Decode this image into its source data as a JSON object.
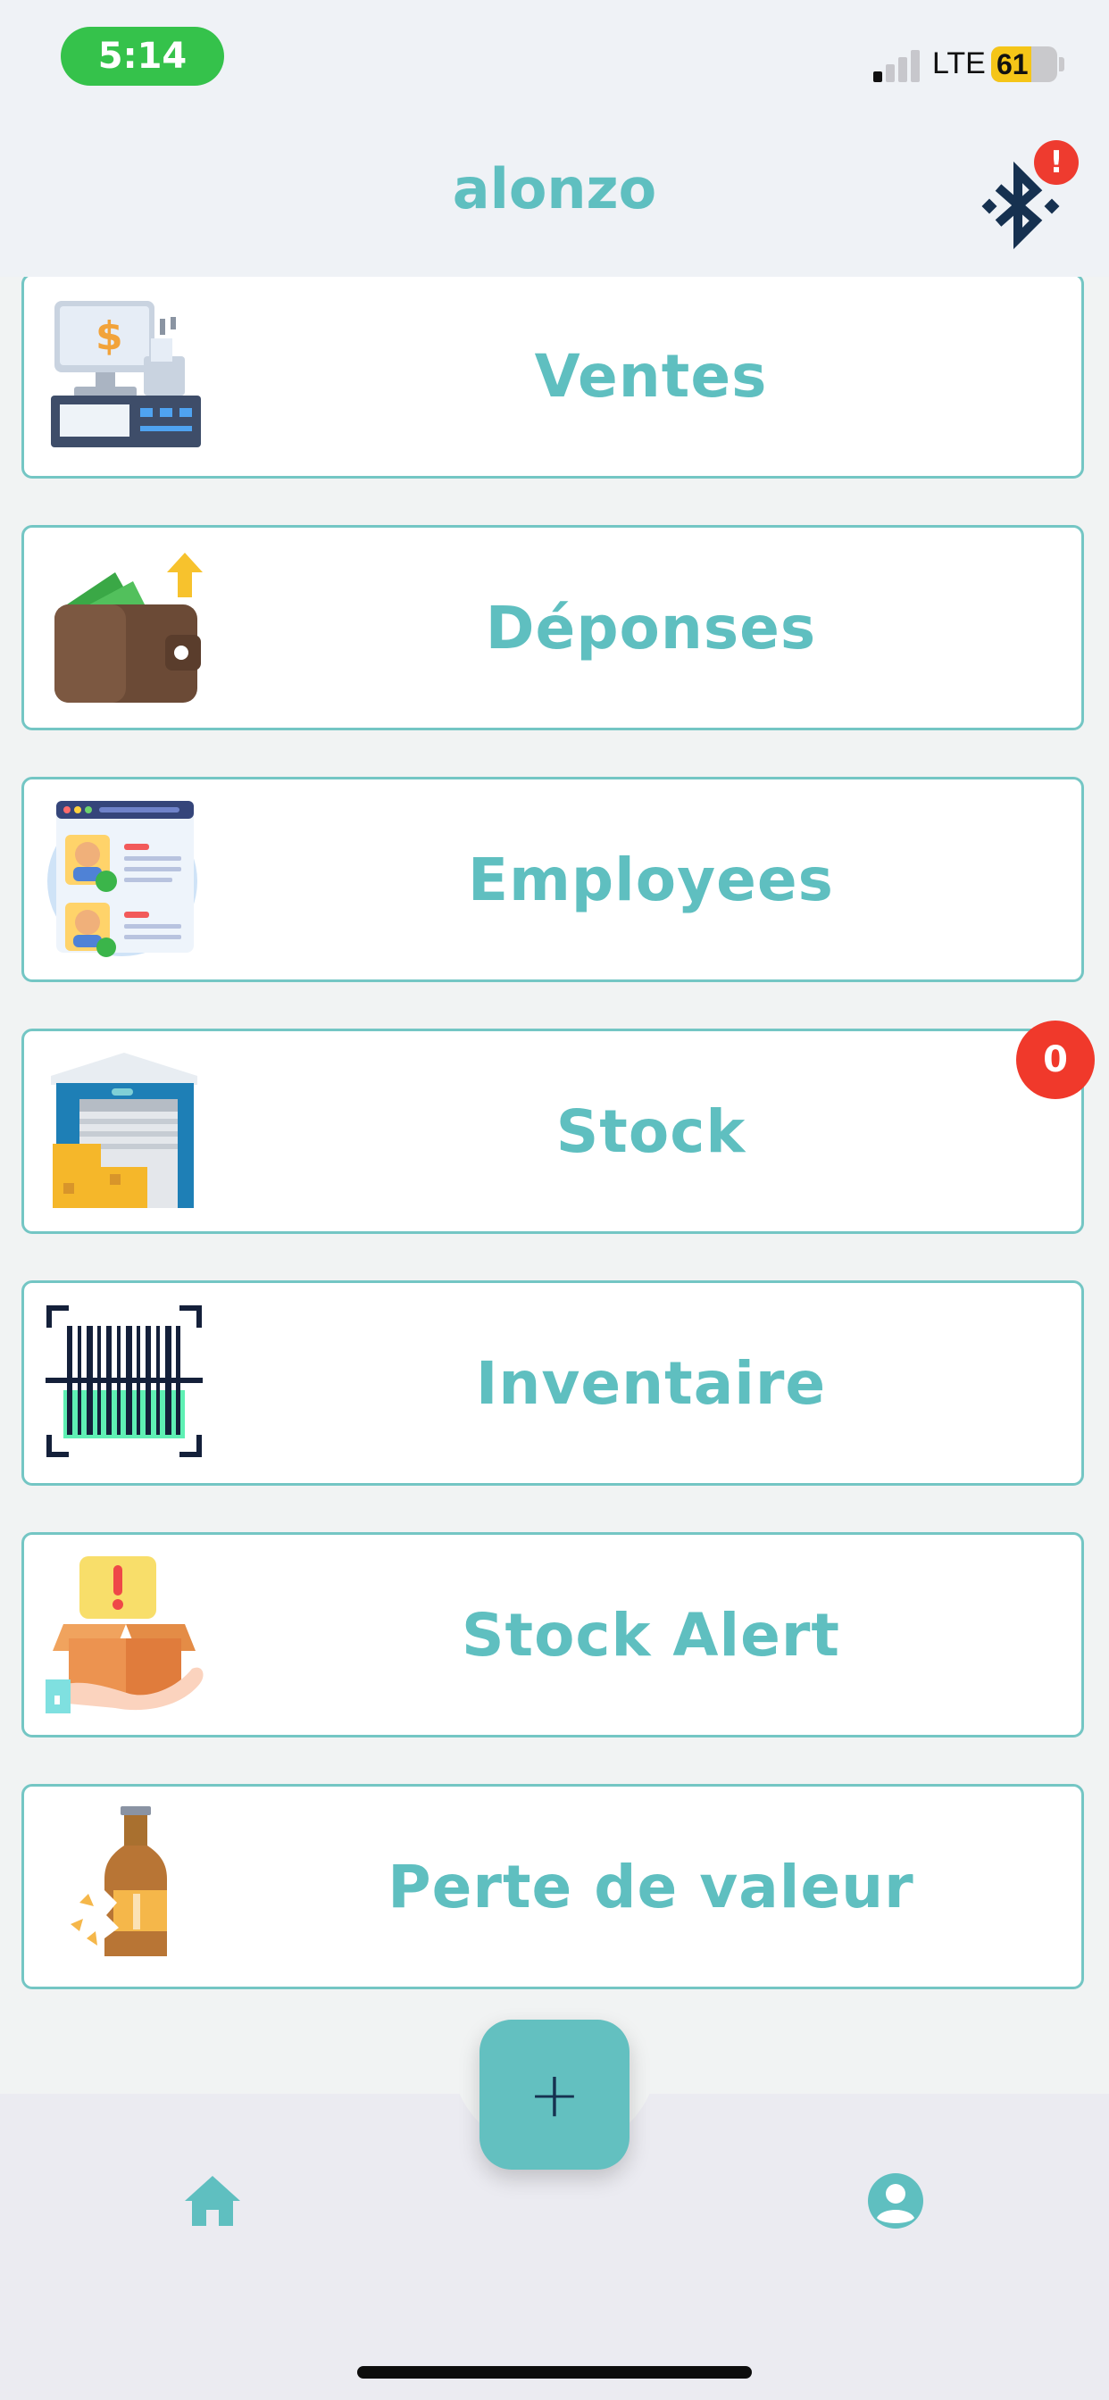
{
  "status_bar": {
    "time": "5:14",
    "network": "LTE",
    "battery_percent": "61",
    "battery_level": 0.61,
    "signal_bars_filled": 1,
    "signal_bars_total": 4
  },
  "header": {
    "title": "alonzo",
    "bluetooth_alert_badge": "!"
  },
  "menu": {
    "items": [
      {
        "label": "Ventes",
        "icon": "cash-register-icon"
      },
      {
        "label": "Déponses",
        "icon": "wallet-icon"
      },
      {
        "label": "Employees",
        "icon": "employee-profiles-icon"
      },
      {
        "label": "Stock",
        "icon": "warehouse-icon",
        "badge": "0"
      },
      {
        "label": "Inventaire",
        "icon": "barcode-scan-icon"
      },
      {
        "label": "Stock Alert",
        "icon": "alert-box-icon"
      },
      {
        "label": "Perte de valeur",
        "icon": "broken-bottle-icon"
      }
    ]
  },
  "bottom_nav": {
    "fab_label": "+",
    "tabs": [
      {
        "icon": "home-icon"
      },
      {
        "icon": "profile-icon"
      }
    ]
  },
  "colors": {
    "accent": "#5fbfc0",
    "card_border": "#74c6c4",
    "badge_red": "#f0392b",
    "time_pill": "#35c24b",
    "bluetooth_icon": "#163150"
  }
}
